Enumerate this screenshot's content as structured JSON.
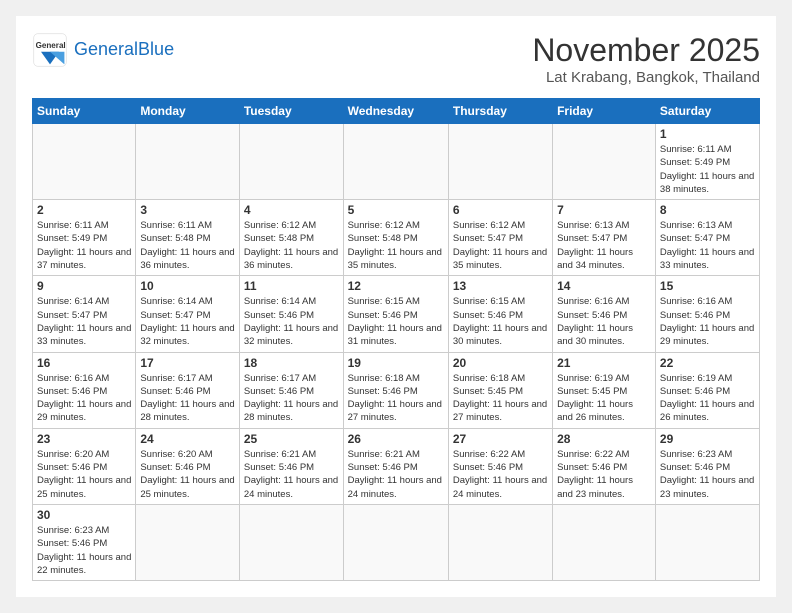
{
  "header": {
    "logo_general": "General",
    "logo_blue": "Blue",
    "title": "November 2025",
    "location": "Lat Krabang, Bangkok, Thailand"
  },
  "weekdays": [
    "Sunday",
    "Monday",
    "Tuesday",
    "Wednesday",
    "Thursday",
    "Friday",
    "Saturday"
  ],
  "weeks": [
    [
      {
        "day": "",
        "sunrise": "",
        "sunset": "",
        "daylight": ""
      },
      {
        "day": "",
        "sunrise": "",
        "sunset": "",
        "daylight": ""
      },
      {
        "day": "",
        "sunrise": "",
        "sunset": "",
        "daylight": ""
      },
      {
        "day": "",
        "sunrise": "",
        "sunset": "",
        "daylight": ""
      },
      {
        "day": "",
        "sunrise": "",
        "sunset": "",
        "daylight": ""
      },
      {
        "day": "",
        "sunrise": "",
        "sunset": "",
        "daylight": ""
      },
      {
        "day": "1",
        "sunrise": "Sunrise: 6:11 AM",
        "sunset": "Sunset: 5:49 PM",
        "daylight": "Daylight: 11 hours and 38 minutes."
      }
    ],
    [
      {
        "day": "2",
        "sunrise": "Sunrise: 6:11 AM",
        "sunset": "Sunset: 5:49 PM",
        "daylight": "Daylight: 11 hours and 37 minutes."
      },
      {
        "day": "3",
        "sunrise": "Sunrise: 6:11 AM",
        "sunset": "Sunset: 5:48 PM",
        "daylight": "Daylight: 11 hours and 36 minutes."
      },
      {
        "day": "4",
        "sunrise": "Sunrise: 6:12 AM",
        "sunset": "Sunset: 5:48 PM",
        "daylight": "Daylight: 11 hours and 36 minutes."
      },
      {
        "day": "5",
        "sunrise": "Sunrise: 6:12 AM",
        "sunset": "Sunset: 5:48 PM",
        "daylight": "Daylight: 11 hours and 35 minutes."
      },
      {
        "day": "6",
        "sunrise": "Sunrise: 6:12 AM",
        "sunset": "Sunset: 5:47 PM",
        "daylight": "Daylight: 11 hours and 35 minutes."
      },
      {
        "day": "7",
        "sunrise": "Sunrise: 6:13 AM",
        "sunset": "Sunset: 5:47 PM",
        "daylight": "Daylight: 11 hours and 34 minutes."
      },
      {
        "day": "8",
        "sunrise": "Sunrise: 6:13 AM",
        "sunset": "Sunset: 5:47 PM",
        "daylight": "Daylight: 11 hours and 33 minutes."
      }
    ],
    [
      {
        "day": "9",
        "sunrise": "Sunrise: 6:14 AM",
        "sunset": "Sunset: 5:47 PM",
        "daylight": "Daylight: 11 hours and 33 minutes."
      },
      {
        "day": "10",
        "sunrise": "Sunrise: 6:14 AM",
        "sunset": "Sunset: 5:47 PM",
        "daylight": "Daylight: 11 hours and 32 minutes."
      },
      {
        "day": "11",
        "sunrise": "Sunrise: 6:14 AM",
        "sunset": "Sunset: 5:46 PM",
        "daylight": "Daylight: 11 hours and 32 minutes."
      },
      {
        "day": "12",
        "sunrise": "Sunrise: 6:15 AM",
        "sunset": "Sunset: 5:46 PM",
        "daylight": "Daylight: 11 hours and 31 minutes."
      },
      {
        "day": "13",
        "sunrise": "Sunrise: 6:15 AM",
        "sunset": "Sunset: 5:46 PM",
        "daylight": "Daylight: 11 hours and 30 minutes."
      },
      {
        "day": "14",
        "sunrise": "Sunrise: 6:16 AM",
        "sunset": "Sunset: 5:46 PM",
        "daylight": "Daylight: 11 hours and 30 minutes."
      },
      {
        "day": "15",
        "sunrise": "Sunrise: 6:16 AM",
        "sunset": "Sunset: 5:46 PM",
        "daylight": "Daylight: 11 hours and 29 minutes."
      }
    ],
    [
      {
        "day": "16",
        "sunrise": "Sunrise: 6:16 AM",
        "sunset": "Sunset: 5:46 PM",
        "daylight": "Daylight: 11 hours and 29 minutes."
      },
      {
        "day": "17",
        "sunrise": "Sunrise: 6:17 AM",
        "sunset": "Sunset: 5:46 PM",
        "daylight": "Daylight: 11 hours and 28 minutes."
      },
      {
        "day": "18",
        "sunrise": "Sunrise: 6:17 AM",
        "sunset": "Sunset: 5:46 PM",
        "daylight": "Daylight: 11 hours and 28 minutes."
      },
      {
        "day": "19",
        "sunrise": "Sunrise: 6:18 AM",
        "sunset": "Sunset: 5:46 PM",
        "daylight": "Daylight: 11 hours and 27 minutes."
      },
      {
        "day": "20",
        "sunrise": "Sunrise: 6:18 AM",
        "sunset": "Sunset: 5:45 PM",
        "daylight": "Daylight: 11 hours and 27 minutes."
      },
      {
        "day": "21",
        "sunrise": "Sunrise: 6:19 AM",
        "sunset": "Sunset: 5:45 PM",
        "daylight": "Daylight: 11 hours and 26 minutes."
      },
      {
        "day": "22",
        "sunrise": "Sunrise: 6:19 AM",
        "sunset": "Sunset: 5:46 PM",
        "daylight": "Daylight: 11 hours and 26 minutes."
      }
    ],
    [
      {
        "day": "23",
        "sunrise": "Sunrise: 6:20 AM",
        "sunset": "Sunset: 5:46 PM",
        "daylight": "Daylight: 11 hours and 25 minutes."
      },
      {
        "day": "24",
        "sunrise": "Sunrise: 6:20 AM",
        "sunset": "Sunset: 5:46 PM",
        "daylight": "Daylight: 11 hours and 25 minutes."
      },
      {
        "day": "25",
        "sunrise": "Sunrise: 6:21 AM",
        "sunset": "Sunset: 5:46 PM",
        "daylight": "Daylight: 11 hours and 24 minutes."
      },
      {
        "day": "26",
        "sunrise": "Sunrise: 6:21 AM",
        "sunset": "Sunset: 5:46 PM",
        "daylight": "Daylight: 11 hours and 24 minutes."
      },
      {
        "day": "27",
        "sunrise": "Sunrise: 6:22 AM",
        "sunset": "Sunset: 5:46 PM",
        "daylight": "Daylight: 11 hours and 24 minutes."
      },
      {
        "day": "28",
        "sunrise": "Sunrise: 6:22 AM",
        "sunset": "Sunset: 5:46 PM",
        "daylight": "Daylight: 11 hours and 23 minutes."
      },
      {
        "day": "29",
        "sunrise": "Sunrise: 6:23 AM",
        "sunset": "Sunset: 5:46 PM",
        "daylight": "Daylight: 11 hours and 23 minutes."
      }
    ],
    [
      {
        "day": "30",
        "sunrise": "Sunrise: 6:23 AM",
        "sunset": "Sunset: 5:46 PM",
        "daylight": "Daylight: 11 hours and 22 minutes."
      },
      {
        "day": "",
        "sunrise": "",
        "sunset": "",
        "daylight": ""
      },
      {
        "day": "",
        "sunrise": "",
        "sunset": "",
        "daylight": ""
      },
      {
        "day": "",
        "sunrise": "",
        "sunset": "",
        "daylight": ""
      },
      {
        "day": "",
        "sunrise": "",
        "sunset": "",
        "daylight": ""
      },
      {
        "day": "",
        "sunrise": "",
        "sunset": "",
        "daylight": ""
      },
      {
        "day": "",
        "sunrise": "",
        "sunset": "",
        "daylight": ""
      }
    ]
  ]
}
